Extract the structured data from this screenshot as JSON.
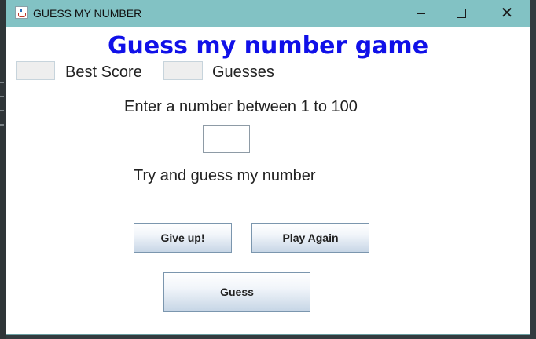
{
  "window": {
    "title": "GUESS MY NUMBER",
    "icon": "java-cup-icon",
    "controls": {
      "minimize": "minimize-icon",
      "maximize": "maximize-icon",
      "close": "✕"
    }
  },
  "game": {
    "heading": "Guess my number game",
    "best_score": {
      "label": "Best Score",
      "value": ""
    },
    "guesses": {
      "label": "Guesses",
      "value": ""
    },
    "prompt": "Enter a number between 1 to 100",
    "input_value": "",
    "feedback": "Try and guess my number"
  },
  "buttons": {
    "give_up": "Give up!",
    "play_again": "Play Again",
    "guess": "Guess"
  },
  "colors": {
    "titlebar": "#82c2c4",
    "heading": "#1010e8",
    "button_border": "#7b96ae"
  }
}
